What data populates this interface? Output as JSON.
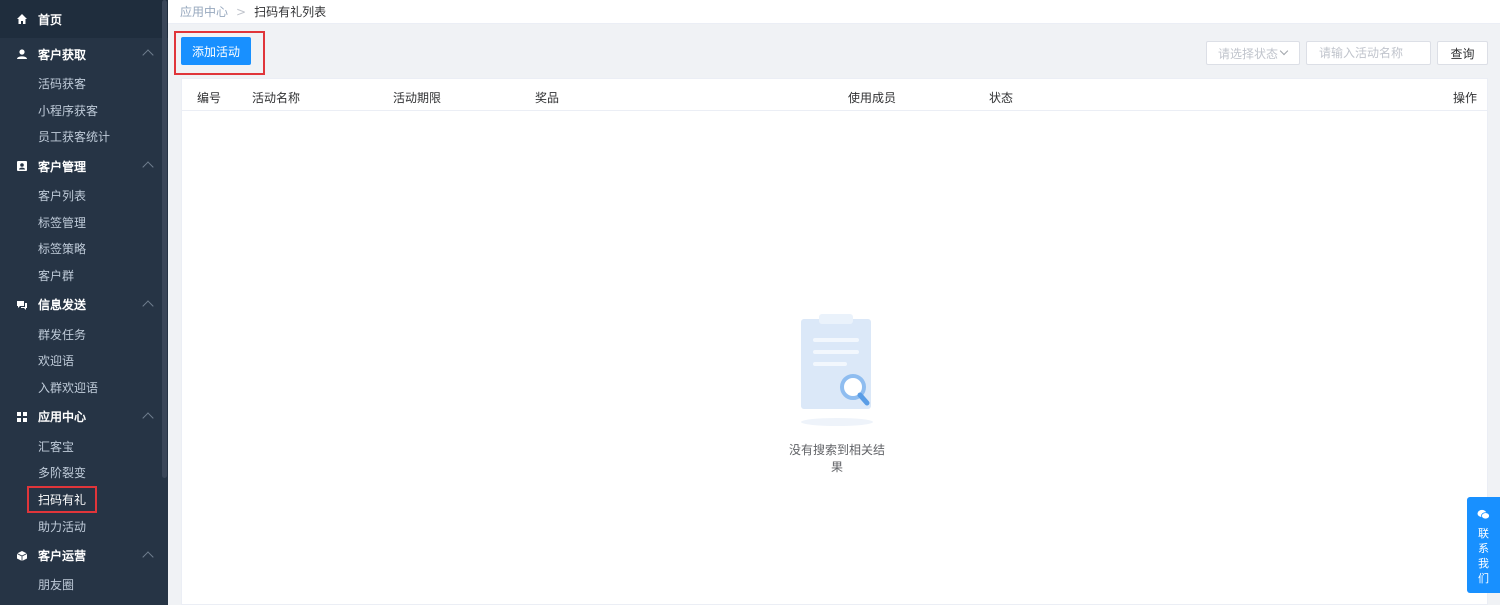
{
  "sidebar": {
    "home": "首页",
    "groups": [
      {
        "title": "客户获取",
        "items": [
          "活码获客",
          "小程序获客",
          "员工获客统计"
        ]
      },
      {
        "title": "客户管理",
        "items": [
          "客户列表",
          "标签管理",
          "标签策略",
          "客户群"
        ]
      },
      {
        "title": "信息发送",
        "items": [
          "群发任务",
          "欢迎语",
          "入群欢迎语"
        ]
      },
      {
        "title": "应用中心",
        "items": [
          "汇客宝",
          "多阶裂变",
          "扫码有礼",
          "助力活动"
        ]
      },
      {
        "title": "客户运营",
        "items": [
          "朋友圈"
        ]
      }
    ]
  },
  "breadcrumb": {
    "parent": "应用中心",
    "separator": ">",
    "current": "扫码有礼列表"
  },
  "toolbar": {
    "add_label": "添加活动",
    "status_placeholder": "请选择状态",
    "name_placeholder": "请输入活动名称",
    "query_label": "查询"
  },
  "table": {
    "columns": [
      "编号",
      "活动名称",
      "活动期限",
      "奖品",
      "使用成员",
      "状态",
      "操作"
    ],
    "empty_text": "没有搜索到相关结果"
  },
  "contact": {
    "chars": [
      "联",
      "系",
      "我",
      "们"
    ]
  },
  "colors": {
    "primary": "#1890ff",
    "sidebar": "#263445",
    "highlight": "#e0353a"
  }
}
